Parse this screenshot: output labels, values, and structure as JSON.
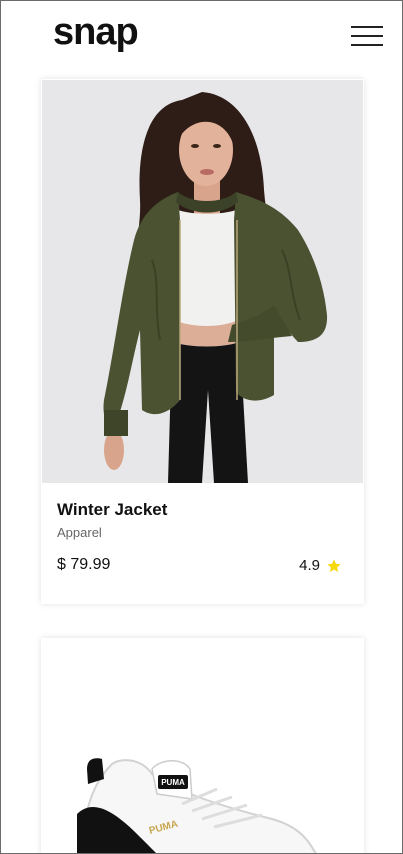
{
  "header": {
    "logo": "snap",
    "menu_icon": "hamburger-menu-icon"
  },
  "products": [
    {
      "title": "Winter Jacket",
      "category": "Apparel",
      "price": "$ 79.99",
      "rating": "4.9",
      "rating_icon": "star-icon",
      "star_color": "#F5D90A"
    },
    {
      "brand_mark": "PUMA"
    }
  ],
  "colors": {
    "jacket": "#4A5232",
    "photo_bg": "#E7E7E9",
    "text": "#111111",
    "muted": "#666666"
  }
}
